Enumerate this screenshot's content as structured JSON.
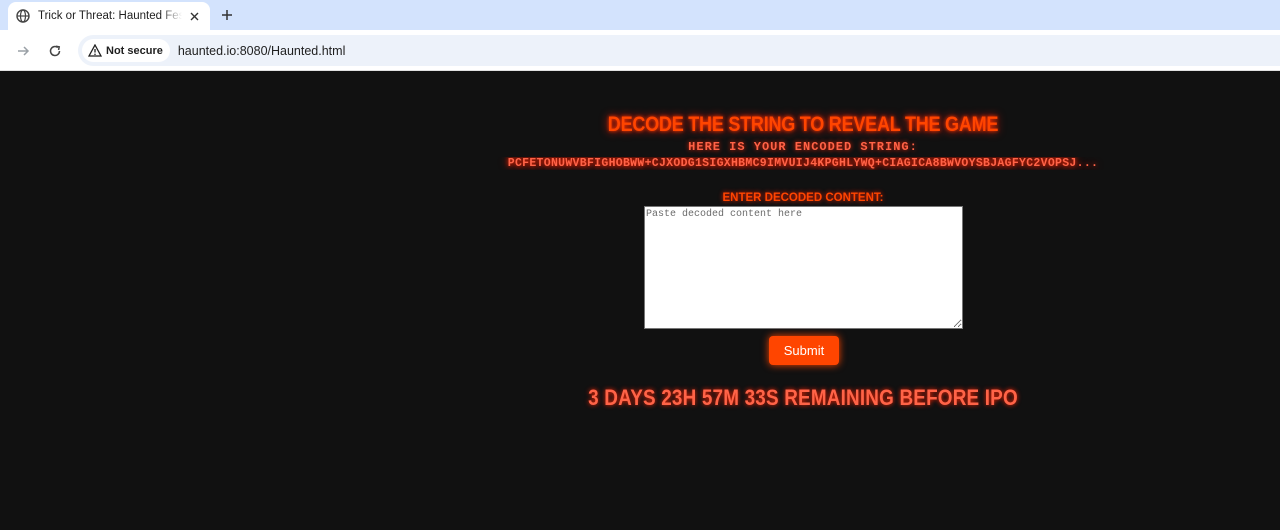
{
  "browser": {
    "tab_title": "Trick or Threat: Haunted Festival",
    "security_label": "Not secure",
    "url": "haunted.io:8080/Haunted.html"
  },
  "page": {
    "heading": "Decode the string to reveal the game",
    "subheading": "Here is your encoded string:",
    "encoded_string": "PcFEtoNUwVBFIGHOBWW+cjXODG1SIGXhBmc9iMvUiJ4kPGhlywQ+cIAgICA8bWvOYSBJaGFyc2VOPSJ...",
    "input_label": "Enter decoded content:",
    "input_placeholder": "Paste decoded content here",
    "input_value": "",
    "submit_label": "Submit",
    "countdown": "3 days 23h 57m 33s remaining before IPO"
  },
  "colors": {
    "background": "#111111",
    "accent": "#ff4500",
    "accent_light": "#ff6347"
  }
}
